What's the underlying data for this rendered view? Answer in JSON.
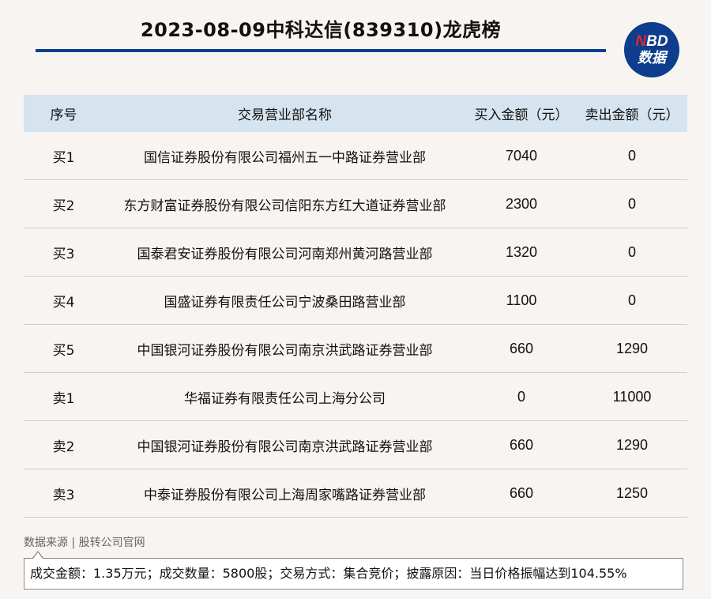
{
  "title": "2023-08-09中科达信(839310)龙虎榜",
  "logo": {
    "top_n": "N",
    "top_rest": "BD",
    "bottom": "数据"
  },
  "colors": {
    "accent": "#0b3f8f",
    "header_bg": "#d6e4ef",
    "logo_red": "#e8262d"
  },
  "table": {
    "headers": [
      "序号",
      "交易营业部名称",
      "买入金额（元）",
      "卖出金额（元）"
    ],
    "rows": [
      [
        "买1",
        "国信证券股份有限公司福州五一中路证券营业部",
        "7040",
        "0"
      ],
      [
        "买2",
        "东方财富证券股份有限公司信阳东方红大道证券营业部",
        "2300",
        "0"
      ],
      [
        "买3",
        "国泰君安证券股份有限公司河南郑州黄河路营业部",
        "1320",
        "0"
      ],
      [
        "买4",
        "国盛证券有限责任公司宁波桑田路营业部",
        "1100",
        "0"
      ],
      [
        "买5",
        "中国银河证券股份有限公司南京洪武路证券营业部",
        "660",
        "1290"
      ],
      [
        "卖1",
        "华福证券有限责任公司上海分公司",
        "0",
        "11000"
      ],
      [
        "卖2",
        "中国银河证券股份有限公司南京洪武路证券营业部",
        "660",
        "1290"
      ],
      [
        "卖3",
        "中泰证券股份有限公司上海周家嘴路证券营业部",
        "660",
        "1250"
      ]
    ]
  },
  "source": "数据来源 | 股转公司官网",
  "note": "成交金额：1.35万元；成交数量：5800股；交易方式：集合竞价；披露原因：当日价格振幅达到104.55%"
}
